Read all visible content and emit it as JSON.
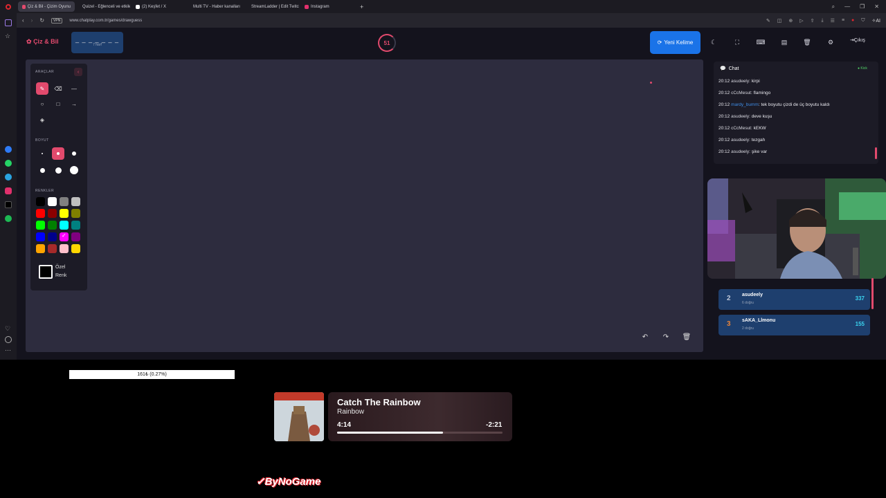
{
  "browser": {
    "tabs": [
      {
        "label": "Çiz & Bil - Çizim Oyunu",
        "active": true,
        "color": "#e24a6d"
      },
      {
        "label": "Quizel - Eğlenceli ve etkile",
        "active": false,
        "color": "#d0a020"
      },
      {
        "label": "(2) Keşfet / X",
        "active": false,
        "color": "#ffffff"
      },
      {
        "label": "Multi TV - Haber kanalları",
        "active": false,
        "color": "#cccccc"
      },
      {
        "label": "StreamLadder | Edit Twitch",
        "active": false,
        "color": "#5b4ee8"
      },
      {
        "label": "Instagram",
        "active": false,
        "color": "#e1306c"
      }
    ],
    "new_tab": "+",
    "url": "www.chatplay.com.tr/games/drawguess",
    "vpn_label": "VPN"
  },
  "app": {
    "logo": "Çiz & Bil",
    "word_hint": "_ _ _ _ _ _ _",
    "word_letters": "7 harf",
    "timer": "51",
    "new_word": "Yeni Kelime",
    "logout": "Çıkış"
  },
  "tools": {
    "title": "ARAÇLAR",
    "size_title": "BOYUT",
    "colors_title": "RENKLER",
    "custom_color_line1": "Özel",
    "custom_color_line2": "Renk",
    "swatches": [
      "#000000",
      "#ffffff",
      "#808080",
      "#c0c0c0",
      "#ff0000",
      "#8b0000",
      "#ffff00",
      "#808000",
      "#00ff00",
      "#008000",
      "#00ffff",
      "#008080",
      "#0000ff",
      "#00008b",
      "#ff00ff",
      "#800080",
      "#ffa500",
      "#a52a2a",
      "#ffc0cb",
      "#ffd700"
    ],
    "selected_swatch": 14
  },
  "chat": {
    "title": "Chat",
    "status": "Kick",
    "messages": [
      {
        "time": "20:12",
        "user": "asudeely",
        "text": "kirpi",
        "highlight": false
      },
      {
        "time": "20:12",
        "user": "cCcMesut",
        "text": "flamingo",
        "highlight": false
      },
      {
        "time": "20:12",
        "user": "mardy_bumm",
        "text": "tek boyutu çizdi de üç boyutu kaldı",
        "highlight": true
      },
      {
        "time": "20:12",
        "user": "asudeely",
        "text": "deve kuşu",
        "highlight": false
      },
      {
        "time": "20:12",
        "user": "cCcMesut",
        "text": "kEKW",
        "highlight": false
      },
      {
        "time": "20:12",
        "user": "asudeely",
        "text": "tezgah",
        "highlight": false
      },
      {
        "time": "20:12",
        "user": "asudeely",
        "text": "şike var",
        "highlight": false
      }
    ]
  },
  "leaderboard": [
    {
      "rank": "2",
      "name": "asudeely",
      "sub": "6 doğru",
      "points": "337",
      "rank_color": "#c0c8d8"
    },
    {
      "rank": "3",
      "name": "sAKA_Llmonu",
      "sub": "2 doğru",
      "points": "155",
      "rank_color": "#e8843a"
    }
  ],
  "overlay": {
    "donation": "161₺ (0.27%)",
    "song_title": "Catch The Rainbow",
    "artist": "Rainbow",
    "elapsed": "4:14",
    "remaining": "-2:21",
    "progress": 0.64,
    "brand": "ByNoGame"
  }
}
